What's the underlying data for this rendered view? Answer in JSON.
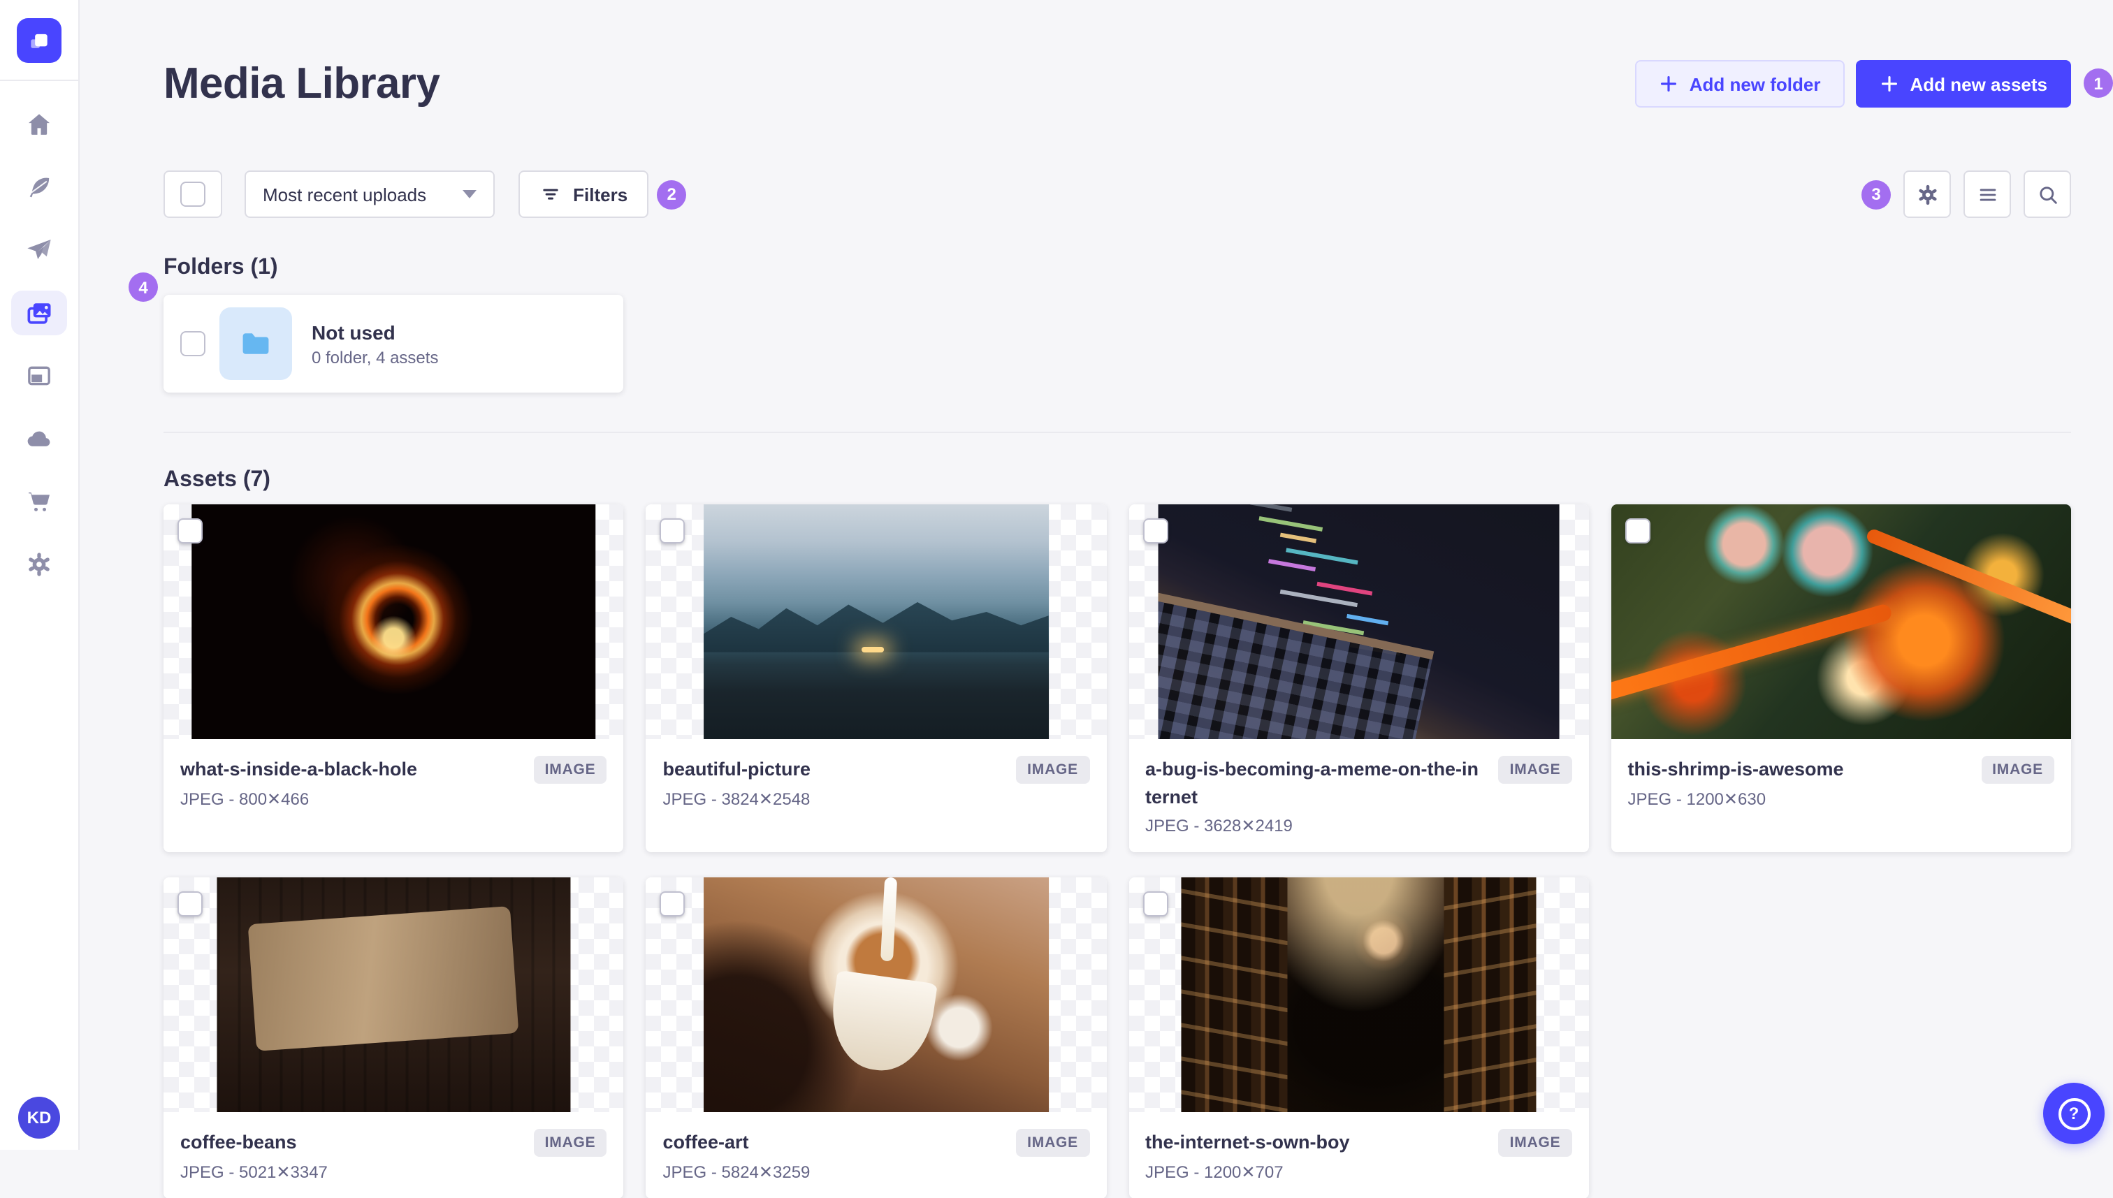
{
  "sidebar": {
    "logo_icon": "strapi-logo-icon",
    "items": [
      {
        "icon": "home-icon"
      },
      {
        "icon": "feather-icon"
      },
      {
        "icon": "paper-plane-icon"
      },
      {
        "icon": "media-library-icon",
        "active": true
      },
      {
        "icon": "content-window-icon"
      },
      {
        "icon": "cloud-icon"
      },
      {
        "icon": "cart-icon"
      },
      {
        "icon": "settings-icon"
      }
    ],
    "avatar_initials": "KD"
  },
  "header": {
    "title": "Media Library",
    "add_folder_label": "Add new folder",
    "add_assets_label": "Add new assets"
  },
  "toolbar": {
    "sort_value": "Most recent uploads",
    "filters_label": "Filters",
    "right_icons": [
      "settings-icon",
      "list-icon",
      "search-icon"
    ]
  },
  "annotations": [
    "1",
    "2",
    "3",
    "4"
  ],
  "folders": {
    "heading": "Folders (1)",
    "items": [
      {
        "name": "Not used",
        "meta": "0 folder, 4 assets",
        "icon": "folder-icon"
      }
    ]
  },
  "assets": {
    "heading": "Assets (7)",
    "items": [
      {
        "title": "what-s-inside-a-black-hole",
        "meta": "JPEG - 800✕466",
        "badge": "IMAGE",
        "thumb": "black-hole"
      },
      {
        "title": "beautiful-picture",
        "meta": "JPEG - 3824✕2548",
        "badge": "IMAGE",
        "thumb": "mountains"
      },
      {
        "title": "a-bug-is-becoming-a-meme-on-the-internet",
        "meta": "JPEG - 3628✕2419",
        "badge": "IMAGE",
        "thumb": "code"
      },
      {
        "title": "this-shrimp-is-awesome",
        "meta": "JPEG - 1200✕630",
        "badge": "IMAGE",
        "thumb": "shrimp"
      },
      {
        "title": "coffee-beans",
        "meta": "JPEG - 5021✕3347",
        "badge": "IMAGE",
        "thumb": "coffee-beans"
      },
      {
        "title": "coffee-art",
        "meta": "JPEG - 5824✕3259",
        "badge": "IMAGE",
        "thumb": "coffee-art"
      },
      {
        "title": "the-internet-s-own-boy",
        "meta": "JPEG - 1200✕707",
        "badge": "IMAGE",
        "thumb": "library"
      }
    ]
  },
  "help": {
    "icon": "question-icon"
  },
  "colors": {
    "primary": "#4945ff",
    "primary_light_bg": "#f0f0ff",
    "annotation_purple": "#a36ef0",
    "text": "#32324d",
    "text_secondary": "#666687",
    "page_bg": "#f6f6f9",
    "border": "#eaeaef",
    "folder_icon_blue": "#66b7f1"
  }
}
